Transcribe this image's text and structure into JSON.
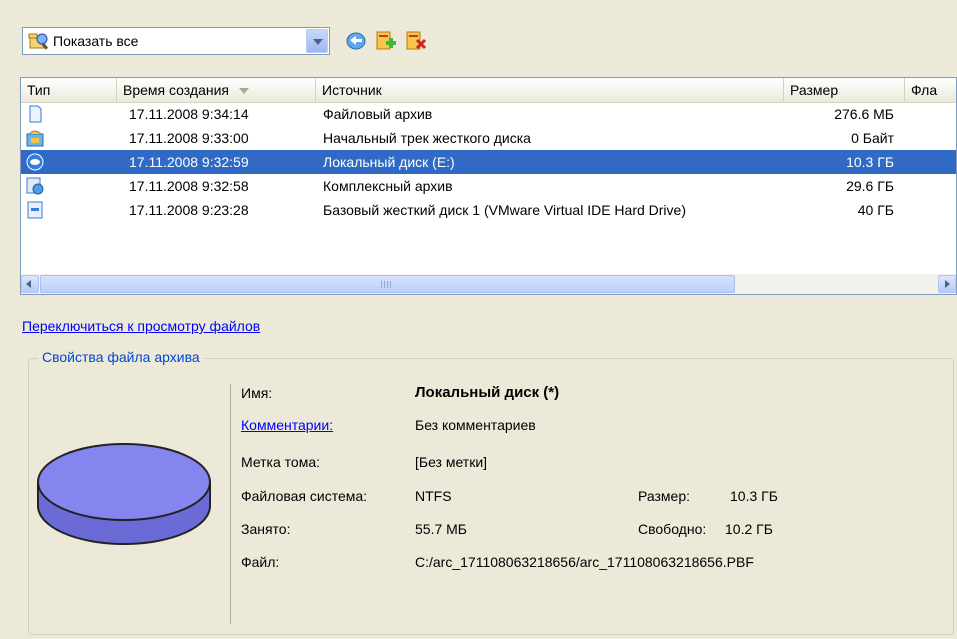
{
  "toolbar": {
    "filter_value": "Показать все",
    "buttons": [
      "refresh-icon",
      "add-archive-icon",
      "remove-archive-icon"
    ]
  },
  "columns": [
    "Тип",
    "Время создания",
    "Источник",
    "Размер",
    "Фла"
  ],
  "rows": [
    {
      "icon": "file-archive-icon",
      "time": "17.11.2008 9:34:14",
      "source": "Файловый архив",
      "size": "276.6 МБ",
      "selected": false
    },
    {
      "icon": "boot-track-icon",
      "time": "17.11.2008 9:33:00",
      "source": "Начальный трек жесткого диска",
      "size": "0 Байт",
      "selected": false
    },
    {
      "icon": "local-disk-icon",
      "time": "17.11.2008 9:32:59",
      "source": "Локальный диск (E:)",
      "size": "10.3 ГБ",
      "selected": true
    },
    {
      "icon": "complex-archive-icon",
      "time": "17.11.2008 9:32:58",
      "source": "Комплексный архив",
      "size": "29.6 ГБ",
      "selected": false
    },
    {
      "icon": "hard-disk-icon",
      "time": "17.11.2008 9:23:28",
      "source": "Базовый жесткий диск 1 (VMware Virtual IDE Hard Drive)",
      "size": "40 ГБ",
      "selected": false
    }
  ],
  "switch_link": "Переключиться к просмотру файлов",
  "properties": {
    "group_title": "Свойства файла архива",
    "name_label": "Имя:",
    "name_value": "Локальный диск (*)",
    "comment_label": "Комментарии:",
    "comment_value": "Без комментариев",
    "volume_label": "Метка тома:",
    "volume_value": "[Без метки]",
    "fs_label": "Файловая система:",
    "fs_value": "NTFS",
    "size_label": "Размер:",
    "size_value": "10.3 ГБ",
    "used_label": "Занято:",
    "used_value": "55.7 МБ",
    "free_label": "Свободно:",
    "free_value": "10.2 ГБ",
    "file_label": "Файл:",
    "file_value": "C:/arc_171108063218656/arc_171108063218656.PBF"
  },
  "colors": {
    "selection": "#316ac5",
    "disk_fill": "#7b7be8",
    "link": "#0000ff",
    "group_title": "#0046d5"
  }
}
